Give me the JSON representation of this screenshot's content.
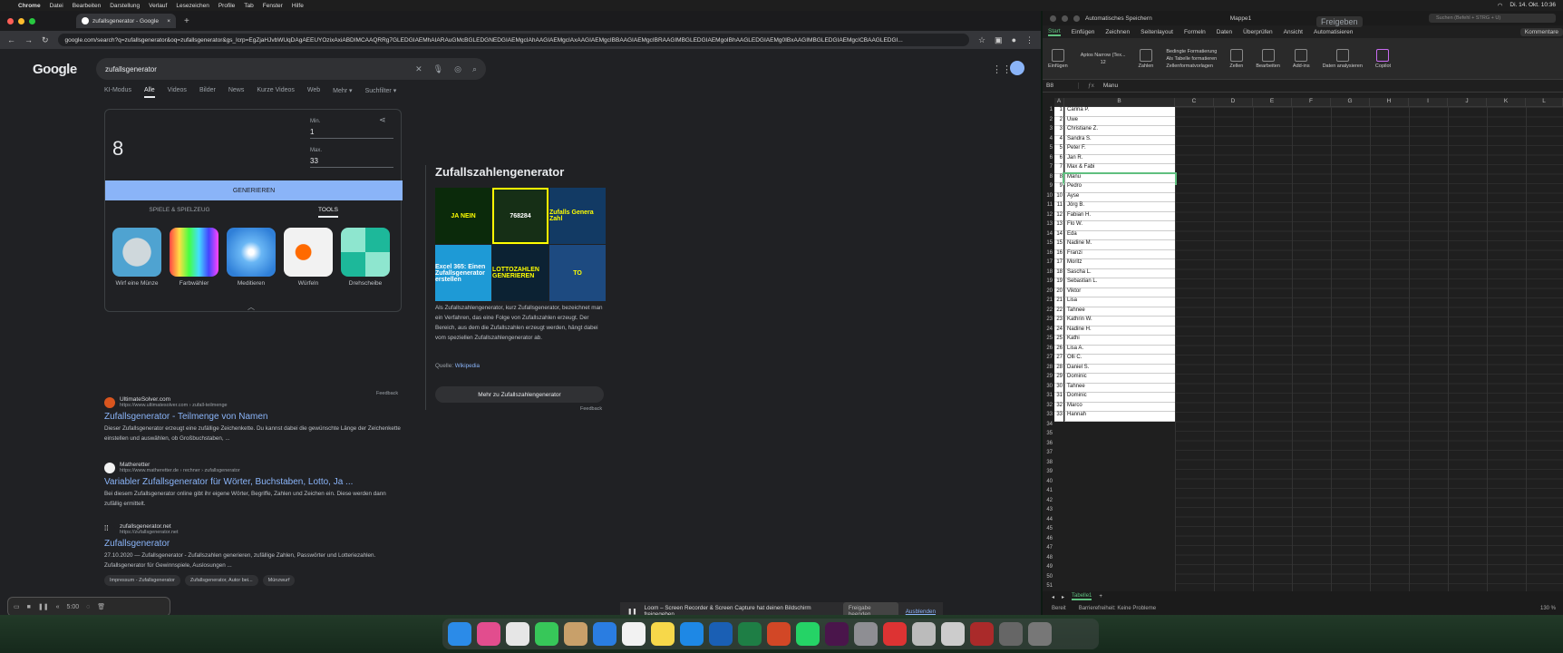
{
  "menubar": {
    "app": "Chrome",
    "items": [
      "Datei",
      "Bearbeiten",
      "Darstellung",
      "Verlauf",
      "Lesezeichen",
      "Profile",
      "Tab",
      "Fenster",
      "Hilfe"
    ],
    "clock": "Di. 14. Okt. 10:36"
  },
  "chrome": {
    "tab_title": "zufallsgenerator - Google",
    "url": "google.com/search?q=zufallsgenerator&oq=zufallsgenerator&gs_lcrp=EgZjaHJvbWUqDAgAEEUYOzixAxiABDIMCAAQRRg7GLEDGIAEMhAIARAuGMcBGLEDGNEDGIAEMgcIAhAAGIAEMgcIAxAAGIAEMgcIBBAAGIAEMgcIBRAAGIMBGLEDGIAEMgoIBhAAGLEDGIAEMg0IBxAAGIMBGLEDGIAEMgcICBAAGLEDGI..."
  },
  "google": {
    "logo": "Google",
    "query": "zufallsgenerator",
    "nav": [
      "KI-Modus",
      "Alle",
      "Videos",
      "Bilder",
      "News",
      "Kurze Videos",
      "Web",
      "Mehr ▾",
      "Suchfilter ▾"
    ],
    "rng": {
      "result": "8",
      "min_label": "Min.",
      "min_value": "1",
      "max_label": "Max.",
      "max_value": "33",
      "button": "GENERIEREN",
      "tab1": "SPIELE & SPIELZEUG",
      "tab2": "TOOLS",
      "tools": [
        "Wirf eine Münze",
        "Farbwähler",
        "Meditieren",
        "Würfeln",
        "Drehscheibe"
      ],
      "feedback": "Feedback"
    },
    "kp": {
      "title": "Zufallszahlengenerator",
      "img_labels": [
        "JA NEIN",
        "768284",
        "Zufalls Genera Zahl",
        "Excel 365: Einen Zufallsgenerator erstellen",
        "LOTTOZAHLEN GENERIEREN",
        "TO"
      ],
      "text": "Als Zufallszahlengenerator, kurz Zufallsgenerator, bezeichnet man ein Verfahren, das eine Folge von Zufallszahlen erzeugt. Der Bereich, aus dem die Zufallszahlen erzeugt werden, hängt dabei vom speziellen Zufallszahlengenerator ab.",
      "source_label": "Quelle:",
      "source_link": "Wikipedia",
      "more": "Mehr zu Zufallszahlengenerator",
      "feedback": "Feedback"
    },
    "results": [
      {
        "site": "UltimateSolver.com",
        "url": "https://www.ultimatesolver.com › zufall-teilmenge",
        "title": "Zufallsgenerator - Teilmenge von Namen",
        "snippet": "Dieser Zufallsgenerator erzeugt eine zufällige Zeichenkette. Du kannst dabei die gewünschte Länge der Zeichenkette einstellen und auswählen, ob Großbuchstaben, ..."
      },
      {
        "site": "Matheretter",
        "url": "https://www.matheretter.de › rechner › zufallsgenerator",
        "title": "Variabler Zufallsgenerator für Wörter, Buchstaben, Lotto, Ja ...",
        "snippet": "Bei diesem Zufallsgenerator online gibt ihr eigene Wörter, Begriffe, Zahlen und Zeichen ein. Diese werden dann zufällig ermittelt."
      },
      {
        "site": "zufallsgenerator.net",
        "url": "https://zufallsgenerator.net",
        "title": "Zufallsgenerator",
        "snippet": "27.10.2020 — Zufallsgenerator - Zufallszahlen generieren, zufällige Zahlen, Passwörter und Lotteriezahlen. Zufallsgenerator für Gewinnspiele, Auslosungen ...",
        "chips": [
          "Impressum - Zufallsgenerator",
          "Zufallsgenerator, Autor bei...",
          "Münzwurf"
        ]
      }
    ]
  },
  "loom": {
    "timer": "5:00",
    "notice": "Loom – Screen Recorder & Screen Capture hat deinen Bildschirm freigegeben.",
    "stop": "Freigabe beenden",
    "hide": "Ausblenden"
  },
  "excel": {
    "autosave": "Automatisches Speichern",
    "filename": "Mappe1",
    "search": "Suchen (Befehl + STRG + U)",
    "tabs": [
      "Start",
      "Einfügen",
      "Zeichnen",
      "Seitenlayout",
      "Formeln",
      "Daten",
      "Überprüfen",
      "Ansicht",
      "Automatisieren"
    ],
    "comments": "Kommentare",
    "share": "Freigeben",
    "font": "Aptos Narrow (Tex...",
    "fontsize": "12",
    "ribbon_items": [
      "Einfügen",
      "Zahlen",
      "Bedingte Formatierung",
      "Als Tabelle formatieren",
      "Zellenformatvorlagen",
      "Zellen",
      "Bearbeiten",
      "Add-ins",
      "Daten analysieren",
      "Copilot"
    ],
    "cell_ref": "B8",
    "formula": "Manu",
    "columns": [
      "A",
      "B",
      "C",
      "D",
      "E",
      "F",
      "G",
      "H",
      "I",
      "J",
      "K",
      "L"
    ],
    "names": [
      "Carina P.",
      "Uwe",
      "Christiane Z.",
      "Sandra S.",
      "Peter F.",
      "Jan R.",
      "Max & Fabi",
      "Manu",
      "Pedro",
      "Ayse",
      "Jörg B.",
      "Fabian H.",
      "Flo W.",
      "Eda",
      "Nadine M.",
      "Franzi",
      "Moritz",
      "Sascha L.",
      "Sebastian L.",
      "Viktor",
      "Lisa",
      "Tahnee",
      "Kathrin W.",
      "Nadine H.",
      "Kathi",
      "Lisa A.",
      "Olli C.",
      "Daniel S.",
      "Dominic",
      "Tahnee",
      "Dominic",
      "Marco",
      "Hannah"
    ],
    "total_rows": 51,
    "sheet": "Tabelle1",
    "status_ready": "Bereit",
    "status_access": "Barrierefreiheit: Keine Probleme",
    "zoom": "130 %"
  },
  "colors": {
    "accent_blue": "#8ab4f8",
    "excel_green": "#5fbf7f",
    "bg_dark": "#202124"
  }
}
